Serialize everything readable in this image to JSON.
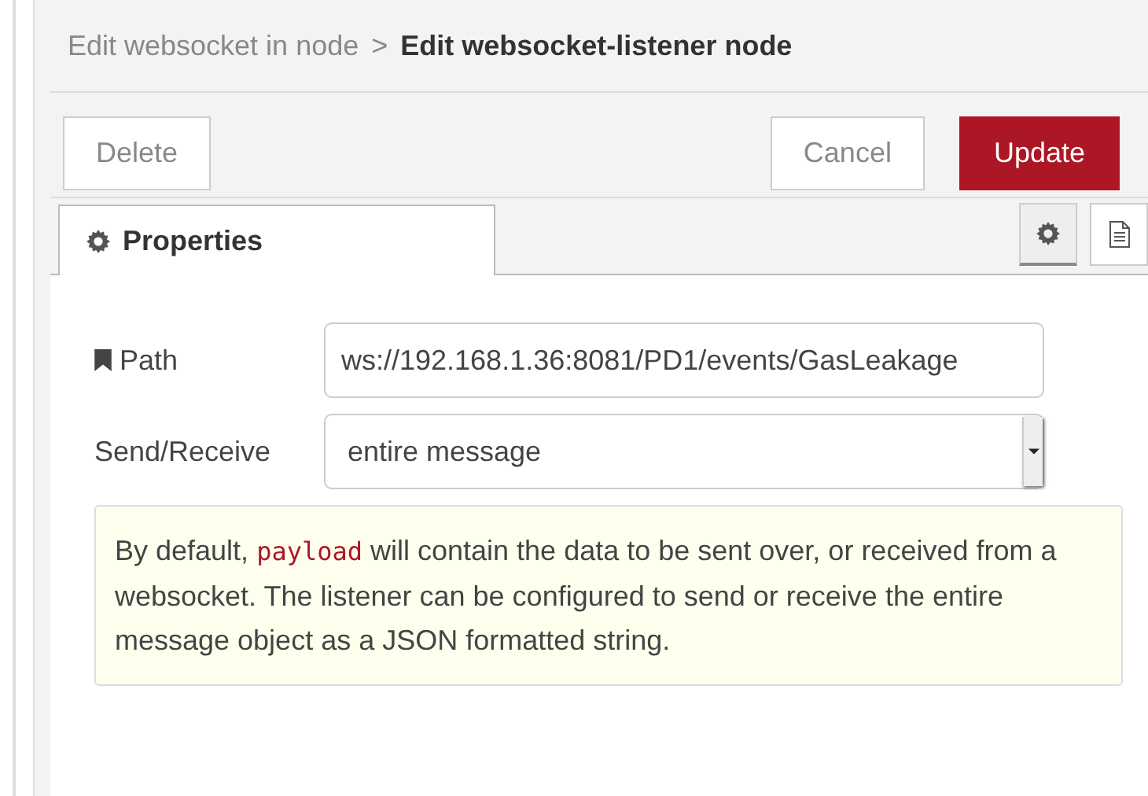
{
  "breadcrumb": {
    "parent": "Edit websocket in node",
    "separator": ">",
    "current": "Edit websocket-listener node"
  },
  "buttons": [
    {
      "kind": "plain",
      "label": "Delete"
    },
    {
      "kind": "plain",
      "label": "Cancel"
    },
    {
      "kind": "primary",
      "label": "Update"
    }
  ],
  "tabs": [
    {
      "label": "Properties",
      "selected": true
    }
  ],
  "side_tabs": [
    {
      "kind": "settings",
      "selected": true
    },
    {
      "kind": "description",
      "selected": false
    }
  ],
  "fields": [
    {
      "kind": "text",
      "label": "Path",
      "value": "ws://192.168.1.36:8081/PD1/events/GasLeakage"
    },
    {
      "kind": "select",
      "label": "Send/Receive",
      "value": "entire message"
    }
  ],
  "tip": [
    {
      "kind": "text",
      "text": "By default, "
    },
    {
      "kind": "code",
      "text": "payload"
    },
    {
      "kind": "text",
      "text": " will contain the data to be sent over, or received from a websocket. The listener can be configured to send or receive the entire message object as a JSON formatted string."
    }
  ]
}
